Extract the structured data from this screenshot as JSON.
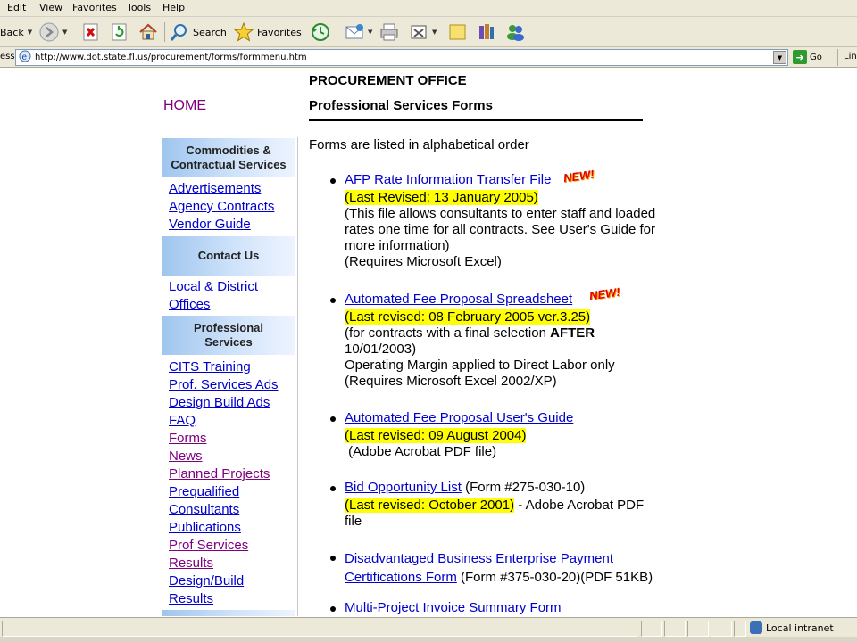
{
  "menu": [
    "Edit",
    "View",
    "Favorites",
    "Tools",
    "Help"
  ],
  "toolbar": {
    "back_label": "Back",
    "search_label": "Search",
    "favorites_label": "Favorites"
  },
  "address": {
    "label": "ess",
    "url": "http://www.dot.state.fl.us/procurement/forms/formmenu.htm",
    "go_label": "Go",
    "links_label": "Lin"
  },
  "header": {
    "office": "PROCUREMENT OFFICE",
    "page_title": "Professional Services Forms",
    "intro": "Forms are listed in alphabetical order"
  },
  "home_label": "HOME",
  "sidebar": {
    "head1": [
      "Commodities &",
      "Contractual Services"
    ],
    "group1": [
      "Advertisements",
      "Agency Contracts",
      "Vendor Guide"
    ],
    "head2": "Contact Us",
    "group2": [
      "Local & District",
      "Offices"
    ],
    "head3": [
      "Professional",
      "Services"
    ],
    "group3": [
      "CITS Training",
      "Prof. Services Ads",
      "Design Build Ads",
      "FAQ",
      "Forms",
      "News",
      "Planned Projects",
      "Prequalified",
      "Consultants",
      "Publications",
      "Prof Services",
      "Results",
      "Design/Build",
      "Results"
    ]
  },
  "new_badge": "NEW!",
  "forms": [
    {
      "link": "AFP Rate Information Transfer File",
      "revised": "(Last Revised: 13 January 2005)",
      "lines": [
        "(This file allows consultants to enter staff and loaded",
        "rates one time for all contracts. See User's Guide for",
        "more information)",
        "(Requires Microsoft Excel)"
      ]
    },
    {
      "link": "Automated Fee Proposal Spreadsheet ",
      "revised": "(Last revised: 08 February 2005 ver.3.25)",
      "line1_pre": "(for contracts with a final selection ",
      "line1_bold": "AFTER",
      "lines": [
        "10/01/2003)",
        "Operating Margin applied to Direct Labor only",
        "(Requires Microsoft Excel 2002/XP)"
      ]
    },
    {
      "link": "Automated Fee Proposal User's Guide",
      "revised": "(Last revised: 09 August 2004)",
      "lines": [
        " (Adobe Acrobat PDF file)"
      ]
    },
    {
      "link": "Bid Opportunity List",
      "after_link": " (Form #275-030-10)",
      "revised": "(Last revised: October 2001)",
      "after_revised": " - Adobe Acrobat PDF",
      "lines": [
        "file"
      ]
    },
    {
      "link_line1": "Disadvantaged Business Enterprise Payment",
      "link_line2": "Certifications Form",
      "after_link": " (Form #375-030-20)(PDF 51KB)"
    },
    {
      "link": "Multi-Project Invoice Summary Form"
    }
  ],
  "status": {
    "zone": "Local intranet"
  }
}
